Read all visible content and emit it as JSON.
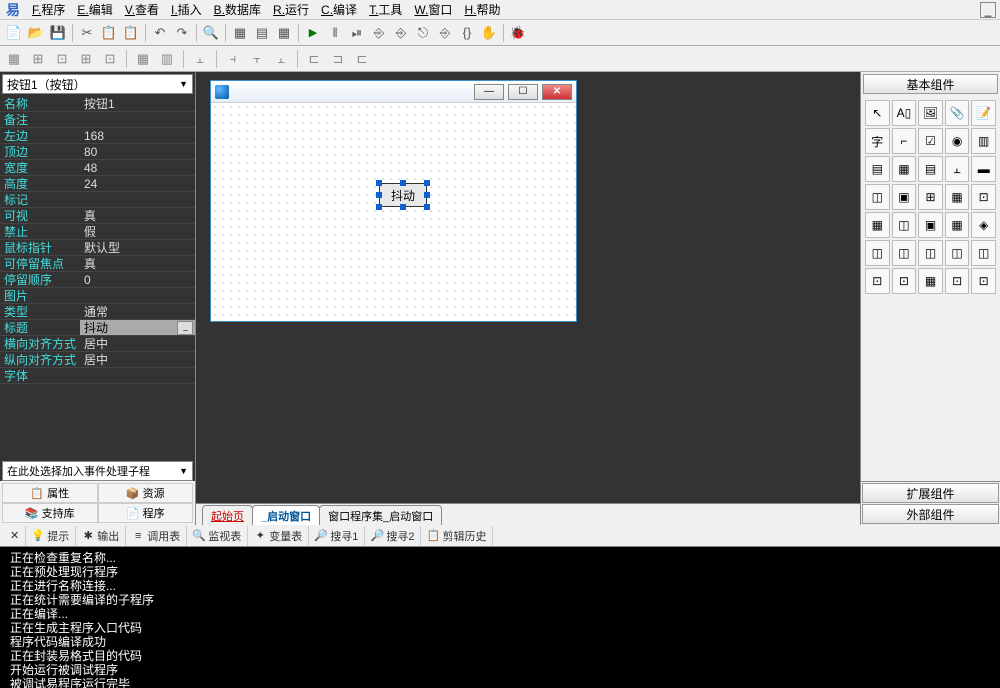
{
  "menu": {
    "items": [
      {
        "hotkey": "F",
        "label": "程序"
      },
      {
        "hotkey": "E",
        "label": "编辑"
      },
      {
        "hotkey": "V",
        "label": "查看"
      },
      {
        "hotkey": "I",
        "label": "插入"
      },
      {
        "hotkey": "B",
        "label": "数据库"
      },
      {
        "hotkey": "R",
        "label": "运行"
      },
      {
        "hotkey": "C",
        "label": "编译"
      },
      {
        "hotkey": "T",
        "label": "工具"
      },
      {
        "hotkey": "W",
        "label": "窗口"
      },
      {
        "hotkey": "H",
        "label": "帮助"
      }
    ]
  },
  "toolbar1": [
    "📄",
    "📂",
    "💾",
    "|",
    "✂",
    "📋",
    "📋",
    "|",
    "↶",
    "↷",
    "|",
    "🔍",
    "|",
    "▦",
    "▤",
    "▦",
    "|",
    "▶",
    "‖",
    "⏯",
    "⎆",
    "⎆",
    "⎋",
    "⎆",
    "{}",
    "✋",
    "|",
    "🐞"
  ],
  "toolbar2": [
    "▦",
    "⊞",
    "⊡",
    "⊞",
    "⊡",
    "|",
    "▦",
    "▥",
    "|",
    "⫠",
    "|",
    "⫞",
    "⫟",
    "⫠",
    "|",
    "⊏",
    "⊐",
    "⊏"
  ],
  "left_panel": {
    "dropdown": "按钮1（按钮）",
    "properties": [
      {
        "name": "名称",
        "val": "按钮1"
      },
      {
        "name": "备注",
        "val": ""
      },
      {
        "name": "左边",
        "val": "168"
      },
      {
        "name": "顶边",
        "val": "80"
      },
      {
        "name": "宽度",
        "val": "48"
      },
      {
        "name": "高度",
        "val": "24"
      },
      {
        "name": "标记",
        "val": ""
      },
      {
        "name": "可视",
        "val": "真"
      },
      {
        "name": "禁止",
        "val": "假"
      },
      {
        "name": "鼠标指针",
        "val": "默认型"
      },
      {
        "name": "可停留焦点",
        "val": "真"
      },
      {
        "name": "停留顺序",
        "val": "0"
      },
      {
        "name": "图片",
        "val": ""
      },
      {
        "name": "类型",
        "val": "通常"
      },
      {
        "name": "标题",
        "val": "抖动",
        "selected": true
      },
      {
        "name": "横向对齐方式",
        "val": "居中"
      },
      {
        "name": "纵向对齐方式",
        "val": "居中"
      },
      {
        "name": "字体",
        "val": ""
      }
    ],
    "event_combo": "在此处选择加入事件处理子程",
    "buttons": [
      "属性",
      "资源",
      "支持库",
      "程序"
    ]
  },
  "form": {
    "button_text": "抖动"
  },
  "bottom_tabs": [
    {
      "label": "起始页",
      "link": true
    },
    {
      "label": "_启动窗口",
      "active": true
    },
    {
      "label": "窗口程序集_启动窗口"
    }
  ],
  "right_panel": {
    "header": "基本组件",
    "icons": [
      "↖",
      "A▯",
      "🖼",
      "📎",
      "📝",
      "字",
      "⌐",
      "☑",
      "◉",
      "▥",
      "▤",
      "▦",
      "▤",
      "⫠",
      "▬",
      "◫",
      "▣",
      "⊞",
      "▦",
      "⊡",
      "▦",
      "◫",
      "▣",
      "▦",
      "◈",
      "◫",
      "◫",
      "◫",
      "◫",
      "◫",
      "⊡",
      "⊡",
      "▦",
      "⊡",
      "⊡"
    ],
    "footer": [
      "扩展组件",
      "外部组件"
    ]
  },
  "output_tabs": [
    {
      "icon": "💡",
      "label": "提示"
    },
    {
      "icon": "✱",
      "label": "输出"
    },
    {
      "icon": "≡",
      "label": "调用表"
    },
    {
      "icon": "🔍",
      "label": "监视表"
    },
    {
      "icon": "✦",
      "label": "变量表"
    },
    {
      "icon": "🔎",
      "label": "搜寻1"
    },
    {
      "icon": "🔎",
      "label": "搜寻2"
    },
    {
      "icon": "📋",
      "label": "剪辑历史"
    }
  ],
  "output_lines": [
    "正在检查重复名称...",
    "正在预处理现行程序",
    "正在进行名称连接...",
    "正在统计需要编译的子程序",
    "正在编译...",
    "正在生成主程序入口代码",
    "程序代码编译成功",
    "正在封装易格式目的代码",
    "开始运行被调试程序",
    "被调试易程序运行完毕"
  ]
}
